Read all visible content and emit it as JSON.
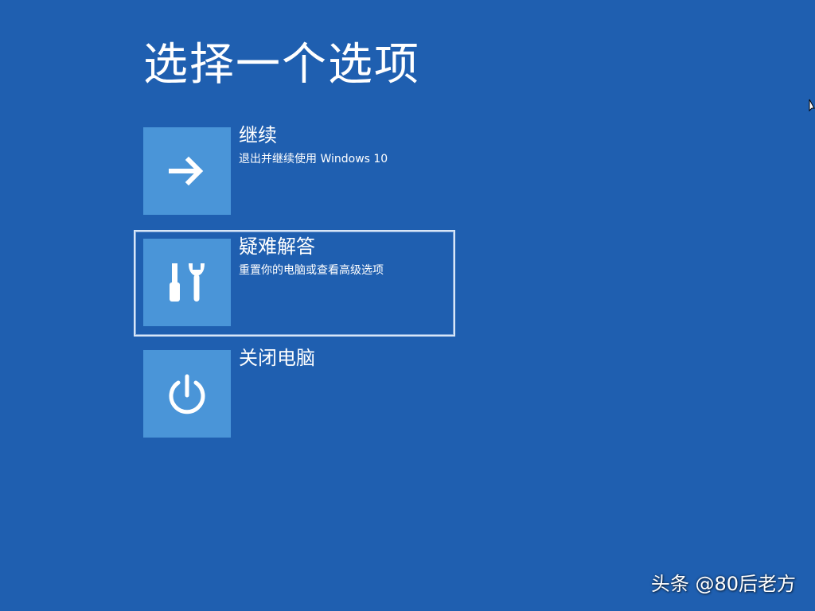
{
  "page": {
    "title": "选择一个选项"
  },
  "options": [
    {
      "title": "继续",
      "description": "退出并继续使用 Windows 10",
      "icon": "arrow-right-icon"
    },
    {
      "title": "疑难解答",
      "description": "重置你的电脑或查看高级选项",
      "icon": "tools-icon",
      "selected": true
    },
    {
      "title": "关闭电脑",
      "description": "",
      "icon": "power-icon"
    }
  ],
  "watermark": {
    "text": "头条 @80后老方"
  },
  "colors": {
    "background": "#1f5fb0",
    "tile": "#4a95d8",
    "selection_border": "#d8e6f7",
    "text": "#ffffff"
  }
}
